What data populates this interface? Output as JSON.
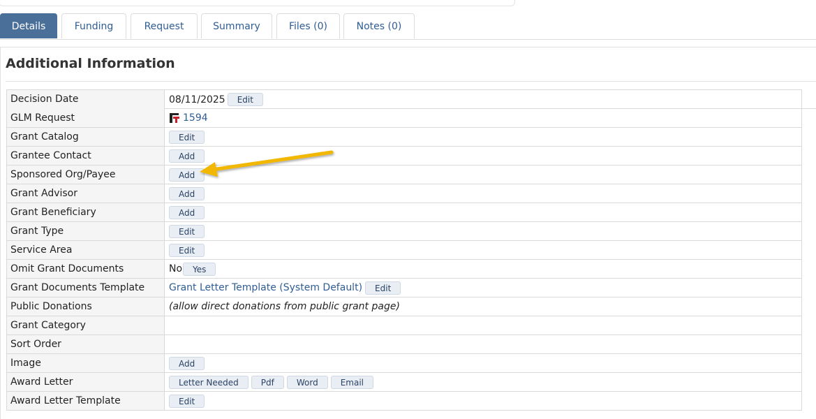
{
  "tabs": [
    {
      "label": "Details",
      "active": true
    },
    {
      "label": "Funding",
      "active": false
    },
    {
      "label": "Request",
      "active": false
    },
    {
      "label": "Summary",
      "active": false
    },
    {
      "label": "Files (0)",
      "active": false
    },
    {
      "label": "Notes (0)",
      "active": false
    }
  ],
  "section": {
    "title": "Additional Information"
  },
  "rows": {
    "decision_date": {
      "label": "Decision Date",
      "value": "08/11/2025",
      "button": "Edit"
    },
    "glm_request": {
      "label": "GLM Request",
      "link": "1594",
      "icon": "glm-logo-icon"
    },
    "grant_catalog": {
      "label": "Grant Catalog",
      "button": "Edit"
    },
    "grantee_contact": {
      "label": "Grantee Contact",
      "button": "Add"
    },
    "sponsored_org": {
      "label": "Sponsored Org/Payee",
      "button": "Add"
    },
    "grant_advisor": {
      "label": "Grant Advisor",
      "button": "Add"
    },
    "grant_beneficiary": {
      "label": "Grant Beneficiary",
      "button": "Add"
    },
    "grant_type": {
      "label": "Grant Type",
      "button": "Edit"
    },
    "service_area": {
      "label": "Service Area",
      "button": "Edit"
    },
    "omit_grant_documents": {
      "label": "Omit Grant Documents",
      "value": "No",
      "button": "Yes"
    },
    "grant_documents_template": {
      "label": "Grant Documents Template",
      "link": "Grant Letter Template (System Default)",
      "button": "Edit"
    },
    "public_donations": {
      "label": "Public Donations",
      "note": "(allow direct donations from public grant page)"
    },
    "grant_category": {
      "label": "Grant Category"
    },
    "sort_order": {
      "label": "Sort Order"
    },
    "image": {
      "label": "Image",
      "button": "Add"
    },
    "award_letter": {
      "label": "Award Letter",
      "buttons": [
        "Letter Needed",
        "Pdf",
        "Word",
        "Email"
      ]
    },
    "award_letter_template": {
      "label": "Award Letter Template",
      "button": "Edit"
    }
  },
  "annotation": {
    "icon": "yellow-arrow-icon",
    "color": "#f2b705"
  }
}
